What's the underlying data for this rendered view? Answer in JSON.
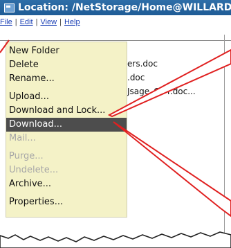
{
  "window": {
    "title": "Location: /NetStorage/Home@WILLARD/My"
  },
  "menubar": {
    "file": "File",
    "edit": "Edit",
    "view": "View",
    "help": "Help"
  },
  "file_menu": {
    "items": [
      {
        "label": "New Folder",
        "enabled": true
      },
      {
        "label": "Delete",
        "enabled": true
      },
      {
        "label": "Rename...",
        "enabled": true
      },
      {
        "label": "Upload...",
        "enabled": true
      },
      {
        "label": "Download and Lock...",
        "enabled": true
      },
      {
        "label": "Download...",
        "enabled": true,
        "selected": true
      },
      {
        "label": "Mail...",
        "enabled": false
      },
      {
        "label": "Purge...",
        "enabled": false
      },
      {
        "label": "Undelete...",
        "enabled": false
      },
      {
        "label": "Archive...",
        "enabled": true
      },
      {
        "label": "Properties...",
        "enabled": true
      }
    ]
  },
  "files": [
    {
      "name": "ers.doc"
    },
    {
      "name": ".doc"
    },
    {
      "name": "Jsage_COT.doc..."
    }
  ],
  "colors": {
    "callout": "#e02020",
    "menu_bg": "#f4f2c7",
    "selected_bg": "#4d4d4d",
    "titlebar": "#1f5c96"
  }
}
